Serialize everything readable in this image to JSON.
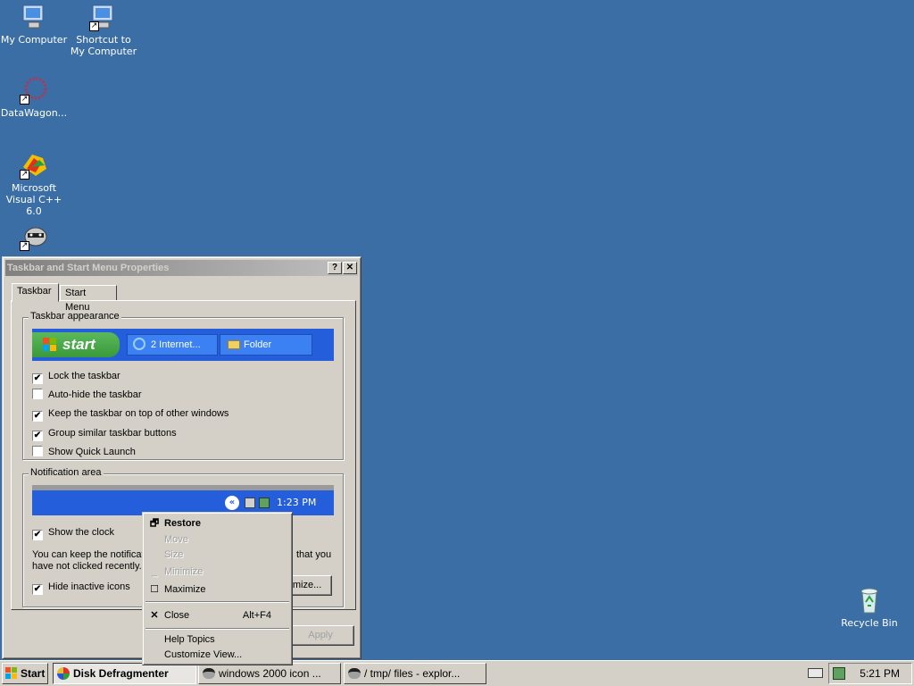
{
  "desktop": {
    "icons": [
      {
        "label": "My Computer"
      },
      {
        "label": "Shortcut to My Computer"
      },
      {
        "label": "DataWagon..."
      },
      {
        "label": "Microsoft Visual C++ 6.0"
      },
      {
        "label": ""
      },
      {
        "label": "Recycle Bin"
      }
    ]
  },
  "dialog": {
    "title": "Taskbar and Start Menu Properties",
    "help_btn": "?",
    "close_btn": "✕",
    "tabs": [
      {
        "label": "Taskbar"
      },
      {
        "label": "Start Menu"
      }
    ],
    "appearance": {
      "legend": "Taskbar appearance",
      "start_label": "start",
      "preview_btn1": "2 Internet...",
      "preview_btn2": "Folder",
      "options": [
        {
          "label": "Lock the taskbar",
          "checked": true
        },
        {
          "label": "Auto-hide the taskbar",
          "checked": false
        },
        {
          "label": "Keep the taskbar on top of other windows",
          "checked": true
        },
        {
          "label": "Group similar taskbar buttons",
          "checked": true
        },
        {
          "label": "Show Quick Launch",
          "checked": false
        }
      ]
    },
    "notification": {
      "legend": "Notification area",
      "preview_time": "1:23 PM",
      "show_clock": "Show the clock",
      "desc_left1": "You can keep the notificat",
      "desc_right1": "that you",
      "desc_left2": "have not clicked recently.",
      "hide_inactive": "Hide inactive icons",
      "customize_btn": "omize..."
    },
    "apply_btn": "Apply"
  },
  "context_menu": {
    "items": [
      {
        "label": "Restore",
        "icon": "restore-icon"
      },
      {
        "label": "Move"
      },
      {
        "label": "Size"
      },
      {
        "label": "Minimize",
        "icon": "minimize-icon"
      },
      {
        "label": "Maximize",
        "icon": "maximize-icon"
      },
      {
        "label": "Close",
        "shortcut": "Alt+F4",
        "icon": "close-icon"
      },
      {
        "label": "Help Topics"
      },
      {
        "label": "Customize View..."
      }
    ]
  },
  "taskbar": {
    "start": "Start",
    "buttons": [
      {
        "label": "Disk Defragmenter"
      },
      {
        "label": "windows 2000 icon ..."
      },
      {
        "label": "/ tmp/ files - explor..."
      }
    ],
    "clock": "5:21 PM"
  }
}
